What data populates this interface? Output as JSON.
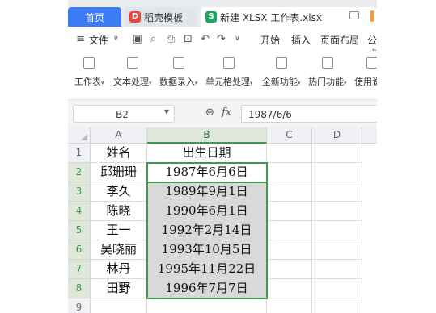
{
  "tabs": {
    "home": "首页",
    "template": "稻壳模板",
    "file": "新建 XLSX 工作表.xlsx"
  },
  "menu": {
    "file": "文件",
    "start": "开始",
    "insert": "插入",
    "page_layout": "页面布局",
    "formula_partial": "公式"
  },
  "ribbon": [
    {
      "label": "工作表",
      "icon": "worksheet-icon"
    },
    {
      "label": "文本处理",
      "icon": "text-process-icon"
    },
    {
      "label": "数据录入",
      "icon": "data-entry-icon"
    },
    {
      "label": "单元格处理",
      "icon": "cell-process-icon"
    },
    {
      "label": "全新功能",
      "icon": "new-feature-icon"
    },
    {
      "label": "热门功能",
      "icon": "hot-feature-icon"
    },
    {
      "label": "使用说明",
      "icon": "help-icon"
    }
  ],
  "formula_bar": {
    "name_box": "B2",
    "fx": "fx",
    "value": "1987/6/6"
  },
  "columns": [
    "A",
    "B",
    "C",
    "D"
  ],
  "rows": [
    "1",
    "2",
    "3",
    "4",
    "5",
    "6",
    "7",
    "8",
    "9"
  ],
  "table": [
    [
      "姓名",
      "出生日期"
    ],
    [
      "邱珊珊",
      "1987年6月6日"
    ],
    [
      "李久",
      "1989年9月1日"
    ],
    [
      "陈晓",
      "1990年6月1日"
    ],
    [
      "王一",
      "1992年2月14日"
    ],
    [
      "吴晓丽",
      "1993年10月5日"
    ],
    [
      "林丹",
      "1995年11月22日"
    ],
    [
      "田野",
      "1996年7月7日"
    ]
  ],
  "colors": {
    "accent_blue": "#3b7cf6",
    "selection_green": "#3c9b4b",
    "highlight_gray": "#d9d9d9"
  }
}
